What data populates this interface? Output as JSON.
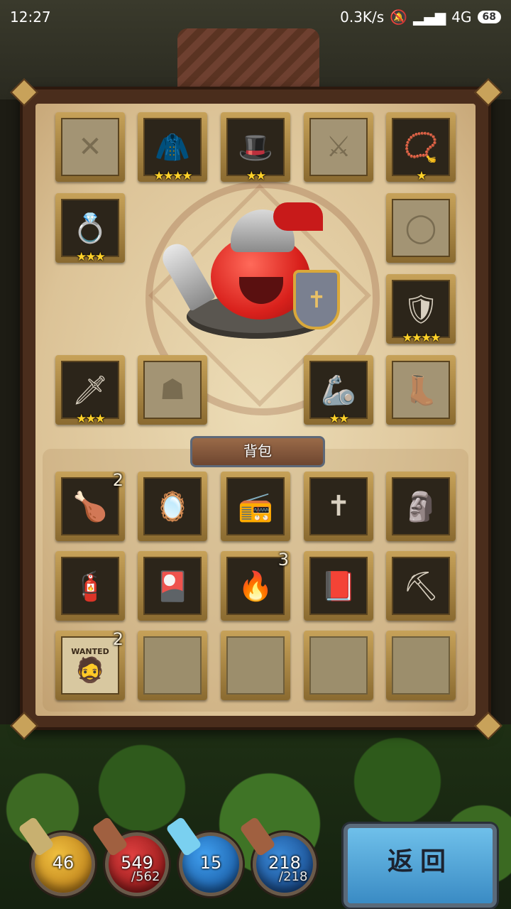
{
  "status_bar": {
    "time": "12:27",
    "net_speed": "0.3K/s",
    "signal": "4G",
    "battery": "68"
  },
  "equipment": {
    "slots": [
      {
        "id": "weapon-off",
        "stars": "",
        "state": "faded",
        "icon": "✕"
      },
      {
        "id": "armor-cloak",
        "stars": "★★★★",
        "state": "filled",
        "icon": "🧥"
      },
      {
        "id": "hat",
        "stars": "★★",
        "state": "filled",
        "icon": "🎩"
      },
      {
        "id": "crossbow",
        "stars": "",
        "state": "faded",
        "icon": "⚔"
      },
      {
        "id": "amulet",
        "stars": "★",
        "state": "filled",
        "icon": "📿"
      },
      {
        "id": "belt",
        "stars": "★★★",
        "state": "filled",
        "icon": "💍"
      },
      {
        "id": "ring",
        "stars": "",
        "state": "faded",
        "icon": "◯"
      },
      {
        "id": "cape",
        "stars": "★★★★",
        "state": "filled",
        "icon": "🛡"
      },
      {
        "id": "dagger",
        "stars": "★★★",
        "state": "filled",
        "icon": "🗡"
      },
      {
        "id": "chest",
        "stars": "",
        "state": "faded",
        "icon": "☗"
      },
      {
        "id": "gauntlet",
        "stars": "★★",
        "state": "filled",
        "icon": "🦾"
      },
      {
        "id": "boots",
        "stars": "",
        "state": "faded",
        "icon": "👢"
      }
    ]
  },
  "bag": {
    "title": "背包",
    "items": [
      {
        "icon": "🍗",
        "count": "2"
      },
      {
        "icon": "🪞",
        "count": ""
      },
      {
        "icon": "📻",
        "count": ""
      },
      {
        "icon": "✝",
        "count": ""
      },
      {
        "icon": "🗿",
        "count": ""
      },
      {
        "icon": "🧯",
        "count": ""
      },
      {
        "icon": "🎴",
        "count": ""
      },
      {
        "icon": "🔥",
        "count": "3"
      },
      {
        "icon": "📕",
        "count": ""
      },
      {
        "icon": "⛏",
        "count": ""
      },
      {
        "icon": "📜",
        "count": "2",
        "label": "WANTED"
      },
      {
        "icon": "",
        "count": ""
      },
      {
        "icon": "",
        "count": ""
      },
      {
        "icon": "",
        "count": ""
      },
      {
        "icon": "",
        "count": ""
      }
    ]
  },
  "stats": {
    "attack": "46",
    "hp": "549",
    "hp_max": "/562",
    "magic": "15",
    "mp": "218",
    "mp_max": "/218"
  },
  "colors": {
    "attack": "#e0a020",
    "hp": "#c02020",
    "magic": "#2a7ac8",
    "mp": "#2a6aa8"
  },
  "back_button": "返回"
}
